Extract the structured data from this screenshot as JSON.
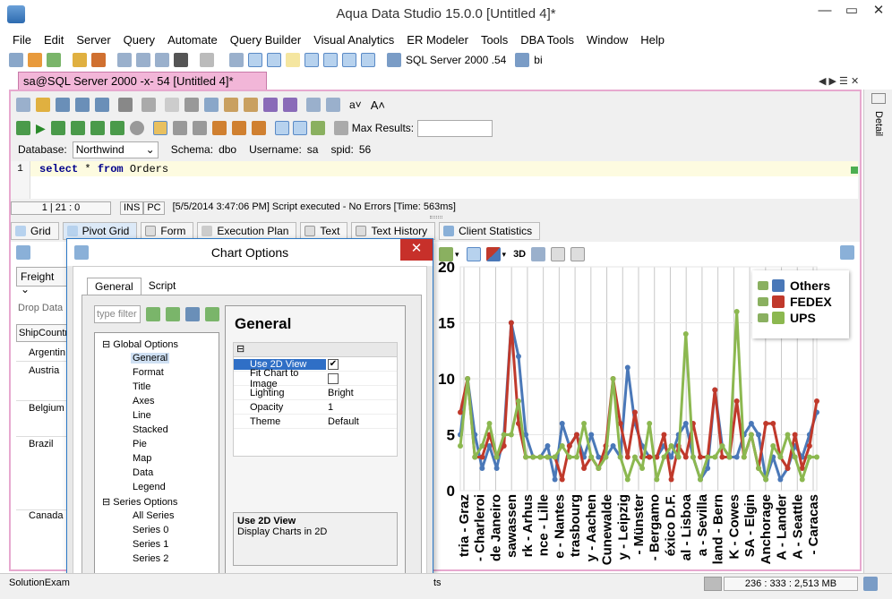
{
  "window": {
    "title": "Aqua Data Studio 15.0.0 [Untitled 4]*",
    "minimize": "—",
    "restore": "▭",
    "close": "✕"
  },
  "menu": [
    "File",
    "Edit",
    "Server",
    "Query",
    "Automate",
    "Query Builder",
    "Visual Analytics",
    "ER Modeler",
    "Tools",
    "DBA Tools",
    "Window",
    "Help"
  ],
  "toolbar": {
    "server": "SQL Server 2000 .54",
    "bi": "bi"
  },
  "doc_tab": "sa@SQL Server 2000 -x- 54 [Untitled 4]*",
  "side_tab": "Detail",
  "query": {
    "max_results_label": "Max Results:",
    "database_label": "Database:",
    "database_value": "Northwind",
    "schema_label": "Schema:",
    "schema_value": "dbo",
    "username_label": "Username:",
    "username_value": "sa",
    "spid_label": "spid:",
    "spid_value": "56",
    "line_no": "1",
    "code_kw1": "select",
    "code_mid": " * ",
    "code_kw2": "from",
    "code_rest": " Orders"
  },
  "status": {
    "pos": "1 | 21 : 0",
    "ins": "INS",
    "pc": "PC",
    "msg": "[5/5/2014 3:47:06 PM] Script executed - No Errors [Time: 563ms]"
  },
  "result_tabs": [
    "Grid",
    "Pivot Grid",
    "Form",
    "Execution Plan",
    "Text",
    "Text History",
    "Client Statistics"
  ],
  "pivot": {
    "field": "Freight",
    "drop_hint": "Drop Data I",
    "ship_field": "ShipCountr",
    "rows": [
      "Argentin",
      "Austria",
      "Belgium",
      "Brazil",
      "Canada"
    ]
  },
  "dialog": {
    "title": "Chart Options",
    "tabs": [
      "General",
      "Script"
    ],
    "filter_placeholder": "type filter",
    "tree": {
      "global": "Global Options",
      "global_items": [
        "General",
        "Format",
        "Title",
        "Axes",
        "Line",
        "Stacked",
        "Pie",
        "Map",
        "Data",
        "Legend"
      ],
      "series": "Series Options",
      "series_items": [
        "All Series",
        "Series 0",
        "Series 1",
        "Series 2"
      ]
    },
    "panel_title": "General",
    "props": [
      {
        "name": "Use 2D View",
        "value": "",
        "checked": true
      },
      {
        "name": "Fit Chart to Image",
        "value": "",
        "checked": false
      },
      {
        "name": "Lighting",
        "value": "Bright"
      },
      {
        "name": "Opacity",
        "value": "1"
      },
      {
        "name": "Theme",
        "value": "Default"
      }
    ],
    "desc_title": "Use 2D View",
    "desc_text": "Display Charts in 2D"
  },
  "chart_toolbar": {
    "label_3d": "3D"
  },
  "chart_data": {
    "type": "line",
    "ylim": [
      0,
      20
    ],
    "yticks": [
      0,
      5,
      10,
      15,
      20
    ],
    "x_tick_labels": [
      "tria - Graz",
      "- Charleroi",
      "de Janeiro",
      "sawassen",
      "rk - Arhus",
      "nce - Lille",
      "e - Nantes",
      "trasbourg",
      "y - Aachen",
      "Cunewalde",
      "y - Leipzig",
      "- Münster",
      "- Bergamo",
      "éxico D.F.",
      "al - Lisboa",
      "a - Sevilla",
      "land - Bern",
      "K - Cowes",
      "SA - Elgin",
      "Anchorage",
      "A - Lander",
      "A - Seattle",
      "- Caracas"
    ],
    "legend_position": "top-right",
    "series": [
      {
        "name": "Others",
        "color": "#4a78b8",
        "values": [
          5,
          10,
          5,
          2,
          4,
          2,
          5,
          15,
          12,
          5,
          3,
          3,
          4,
          1,
          6,
          4,
          5,
          3,
          5,
          3,
          3,
          4,
          3,
          11,
          6,
          4,
          3,
          3,
          4,
          3,
          5,
          6,
          3,
          1,
          2,
          9,
          4,
          3,
          3,
          5,
          6,
          5,
          1,
          3,
          1,
          2,
          4,
          3,
          5,
          7
        ]
      },
      {
        "name": "FEDEX",
        "color": "#c0392b",
        "values": [
          7,
          10,
          3,
          3,
          5,
          3,
          4,
          15,
          6,
          3,
          3,
          3,
          3,
          3,
          1,
          4,
          5,
          2,
          3,
          2,
          4,
          10,
          6,
          3,
          7,
          3,
          3,
          3,
          5,
          1,
          4,
          3,
          6,
          3,
          3,
          9,
          3,
          3,
          8,
          3,
          5,
          2,
          6,
          6,
          3,
          2,
          5,
          2,
          4,
          8
        ]
      },
      {
        "name": "UPS",
        "color": "#8cb850",
        "values": [
          4,
          10,
          3,
          4,
          6,
          3,
          5,
          5,
          8,
          3,
          3,
          3,
          3,
          3,
          4,
          3,
          3,
          6,
          3,
          2,
          3,
          10,
          3,
          1,
          3,
          2,
          6,
          1,
          3,
          4,
          3,
          14,
          3,
          1,
          3,
          3,
          4,
          3,
          16,
          3,
          5,
          2,
          1,
          4,
          3,
          5,
          3,
          1,
          3,
          3
        ]
      }
    ]
  },
  "bottom": {
    "left": "SolutionExam",
    "mid": "ts",
    "memory": "236 : 333 : 2,513 MB"
  }
}
